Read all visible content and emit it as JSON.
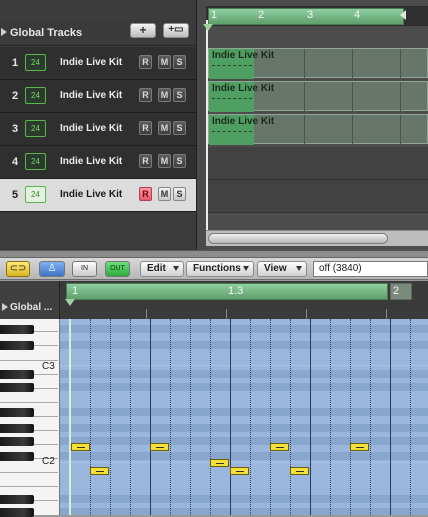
{
  "arrange": {
    "global_tracks_label": "Global Tracks",
    "add_track_glyph": "+",
    "add_folder_glyph": "+▭",
    "ruler_bars": [
      "1",
      "2",
      "3",
      "4"
    ],
    "tracks": [
      {
        "number": "1",
        "icon_text": "24",
        "name": "Indie Live Kit",
        "buttons": [
          "R",
          "M",
          "S"
        ],
        "region_label": "Indie Live Kit"
      },
      {
        "number": "2",
        "icon_text": "24",
        "name": "Indie Live Kit",
        "buttons": [
          "R",
          "M",
          "S"
        ],
        "region_label": "Indie Live Kit"
      },
      {
        "number": "3",
        "icon_text": "24",
        "name": "Indie Live Kit",
        "buttons": [
          "R",
          "M",
          "S"
        ],
        "region_label": "Indie Live Kit"
      },
      {
        "number": "4",
        "icon_text": "24",
        "name": "Indie Live Kit",
        "buttons": [
          "R",
          "M",
          "S"
        ]
      },
      {
        "number": "5",
        "icon_text": "24",
        "name": "Indie Live Kit",
        "buttons": [
          "R",
          "M",
          "S"
        ],
        "selected": true,
        "record_armed": true
      }
    ]
  },
  "editor_toolbar": {
    "link_icon": "link-icon",
    "catch_icon": "walking-man-icon",
    "midi_in_label": "IN",
    "midi_out_label": "OUT",
    "menus": {
      "edit": "Edit",
      "functions": "Functions",
      "view": "View"
    },
    "quantize_value": "off (3840)"
  },
  "piano_roll": {
    "global_label": "Global ...",
    "ruler": {
      "bar_1": "1",
      "beat_label": "1.3",
      "bar_2": "2"
    },
    "octave_labels": {
      "c3": "C3",
      "c2": "C2"
    },
    "notes": [
      {
        "bar": 1,
        "beat": 1.0,
        "pitch": "D2"
      },
      {
        "bar": 1,
        "beat": 1.5,
        "pitch": "C2"
      },
      {
        "bar": 1,
        "beat": 2.0,
        "pitch": "D2"
      },
      {
        "bar": 1,
        "beat": 2.75,
        "pitch": "C#2"
      },
      {
        "bar": 1,
        "beat": 3.0,
        "pitch": "C2"
      },
      {
        "bar": 1,
        "beat": 3.5,
        "pitch": "D2"
      },
      {
        "bar": 1,
        "beat": 3.75,
        "pitch": "C2"
      },
      {
        "bar": 1,
        "beat": 4.5,
        "pitch": "D2"
      }
    ]
  },
  "colors": {
    "cycle_green": "#6fb37f",
    "region_green": "#4f9f63",
    "note_yellow": "#f2e13a",
    "grid_blue": "#9bb6dc",
    "record_red": "#e05a6a"
  }
}
